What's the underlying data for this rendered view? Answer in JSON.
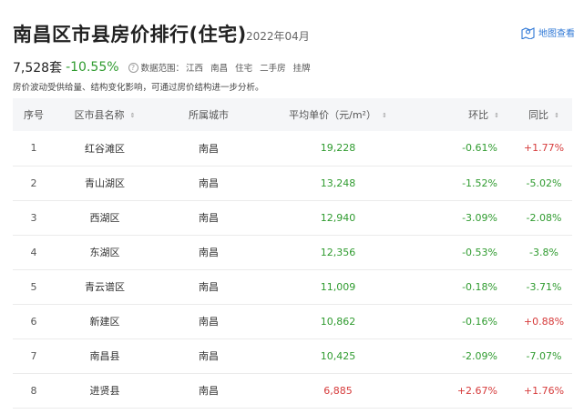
{
  "header": {
    "title": "南昌区市县房价排行(住宅)",
    "date": "2022年04月",
    "map_label": "地图查看",
    "map_icon": "map-pin-icon"
  },
  "stats": {
    "count": "7,528套",
    "change": "-10.55%",
    "help_icon": "?",
    "scope_label": "数据范围：",
    "scope": [
      "江西",
      "南昌",
      "住宅",
      "二手房",
      "挂牌"
    ]
  },
  "note": "房价波动受供给量、结构变化影响，可通过房价结构进一步分析。",
  "table": {
    "columns": [
      "序号",
      "区市县名称",
      "所属城市",
      "平均单价（元/m²）",
      "环比",
      "同比"
    ],
    "sort_icon": "⇕",
    "rows": [
      {
        "rank": "1",
        "district": "红谷滩区",
        "city": "南昌",
        "price": "19,228",
        "mom": "-0.61%",
        "yoy": "+1.77%"
      },
      {
        "rank": "2",
        "district": "青山湖区",
        "city": "南昌",
        "price": "13,248",
        "mom": "-1.52%",
        "yoy": "-5.02%"
      },
      {
        "rank": "3",
        "district": "西湖区",
        "city": "南昌",
        "price": "12,940",
        "mom": "-3.09%",
        "yoy": "-2.08%"
      },
      {
        "rank": "4",
        "district": "东湖区",
        "city": "南昌",
        "price": "12,356",
        "mom": "-0.53%",
        "yoy": "-3.8%"
      },
      {
        "rank": "5",
        "district": "青云谱区",
        "city": "南昌",
        "price": "11,009",
        "mom": "-0.18%",
        "yoy": "-3.71%"
      },
      {
        "rank": "6",
        "district": "新建区",
        "city": "南昌",
        "price": "10,862",
        "mom": "-0.16%",
        "yoy": "+0.88%"
      },
      {
        "rank": "7",
        "district": "南昌县",
        "city": "南昌",
        "price": "10,425",
        "mom": "-2.09%",
        "yoy": "-7.07%"
      },
      {
        "rank": "8",
        "district": "进贤县",
        "city": "南昌",
        "price": "6,885",
        "mom": "+2.67%",
        "yoy": "+1.76%"
      }
    ]
  },
  "colors": {
    "up": "#d63b3b",
    "down": "#2f9b2f",
    "price_up": "#2f9b2f",
    "price_low": "#d63b3b",
    "link": "#2f78d6"
  }
}
